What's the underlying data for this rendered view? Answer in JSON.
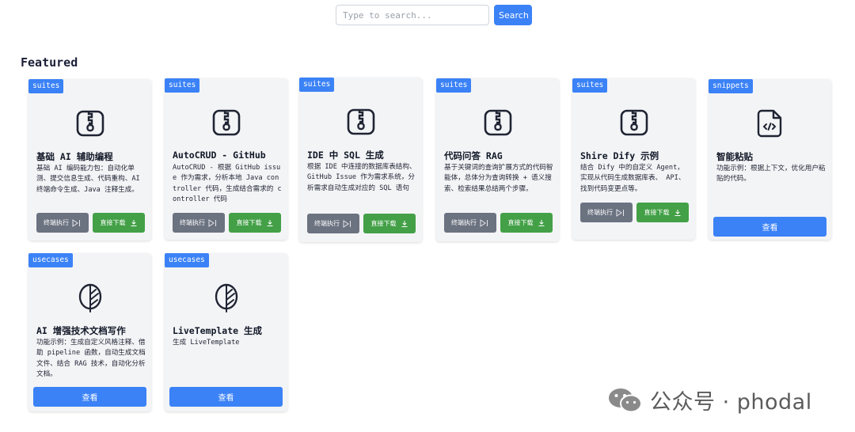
{
  "search": {
    "placeholder": "Type to search...",
    "button_label": "Search"
  },
  "featured_heading": "Featured",
  "cards": [
    {
      "tag": "suites",
      "title": "基础 AI 辅助编程",
      "description": "基础 AI 编码能力包：自动化单测、提交信息生成、代码重构、AI 终端命令生成、Java 注释生成。",
      "exec_label": "终端执行",
      "download_label": "直接下载"
    },
    {
      "tag": "suites",
      "title": "AutoCRUD - GitHub",
      "description": "AutoCRUD - 根据 GitHub issue 作为需求，分析本地 Java controller 代码，生成结合需求的 controller 代码",
      "exec_label": "终端执行",
      "download_label": "直接下载"
    },
    {
      "tag": "suites",
      "title": "IDE 中 SQL 生成",
      "description": "根据 IDE 中连接的数据库表结构、GitHub Issue 作为需求系统，分析需求自动生成对应的 SQL 语句",
      "exec_label": "终端执行",
      "download_label": "直接下载"
    },
    {
      "tag": "suites",
      "title": "代码问答 RAG",
      "description": "基于关键词的查询扩展方式的代码智能体，总体分为查询转换 + 语义搜索、检索结果总结两个步骤。",
      "exec_label": "终端执行",
      "download_label": "直接下载"
    },
    {
      "tag": "suites",
      "title": "Shire Dify 示例",
      "description": "结合 Dify 中的自定义 Agent，实现从代码生成数据库表、 API、找到代码变更点等。",
      "exec_label": "终端执行",
      "download_label": "直接下载"
    },
    {
      "tag": "snippets",
      "title": "智能粘贴",
      "description": "功能示例：根据上下文，优化用户粘贴的代码。",
      "view_label": "查看"
    },
    {
      "tag": "usecases",
      "title": "AI 增强技术文档写作",
      "description": "功能示例：生成自定义风格注释、借助 pipeline 函数，自动生成文档文件、结合 RAG 技术，自动化分析文档。",
      "view_label": "查看"
    },
    {
      "tag": "usecases",
      "title": "LiveTemplate 生成",
      "description": "生成 LiveTemplate",
      "view_label": "查看"
    }
  ],
  "watermark": {
    "text": "公众号 · phodal"
  },
  "colors": {
    "primary": "#3b82f6",
    "exec": "#6b7280",
    "download": "#43a047",
    "card_bg": "#f3f4f6"
  }
}
